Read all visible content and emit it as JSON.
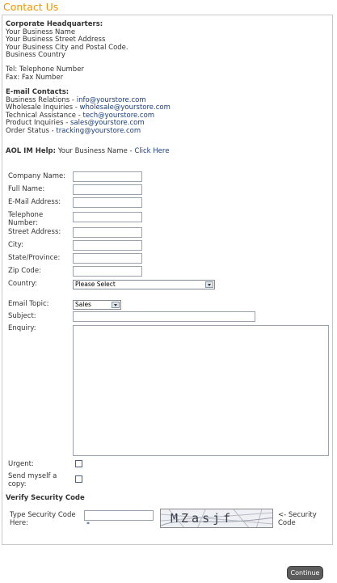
{
  "page": {
    "title": "Contact Us"
  },
  "hq": {
    "heading": "Corporate Headquarters:",
    "lines": [
      "Your Business Name",
      "Your Business Street Address",
      "Your Business City and Postal Code.",
      "Business Country"
    ]
  },
  "phone": {
    "tel": "Tel: Telephone Number",
    "fax": "Fax: Fax Number"
  },
  "email_contacts": {
    "heading": "E-mail Contacts:",
    "items": [
      {
        "label": "Business Relations - ",
        "email": "info@yourstore.com"
      },
      {
        "label": "Wholesale Inquiries - ",
        "email": "wholesale@yourstore.com"
      },
      {
        "label": "Technical Assistance - ",
        "email": "tech@yourstore.com"
      },
      {
        "label": "Product Inquiries - ",
        "email": "sales@yourstore.com"
      },
      {
        "label": "Order Status - ",
        "email": "tracking@yourstore.com"
      }
    ]
  },
  "aol": {
    "label": "AOL IM Help:",
    "name": " Your Business Name - ",
    "link": "Click Here"
  },
  "form": {
    "company_name": "Company Name:",
    "full_name": "Full Name:",
    "email": "E-Mail Address:",
    "telephone_1": "Telephone",
    "telephone_2": "Number:",
    "street": "Street Address:",
    "city": "City:",
    "state": "State/Province:",
    "zip": "Zip Code:",
    "country": "Country:",
    "country_value": "Please Select",
    "email_topic": "Email Topic:",
    "email_topic_value": "Sales",
    "subject": "Subject:",
    "enquiry": "Enquiry:",
    "urgent": "Urgent:",
    "send_copy_1": "Send myself a",
    "send_copy_2": "copy:"
  },
  "security": {
    "heading": "Verify Security Code",
    "label_1": "Type Security Code",
    "label_2": "Here:",
    "required": "*",
    "captcha_text": "MZasjf",
    "hint_1": "<- Security",
    "hint_2": "Code"
  },
  "continue_button": "Continue"
}
